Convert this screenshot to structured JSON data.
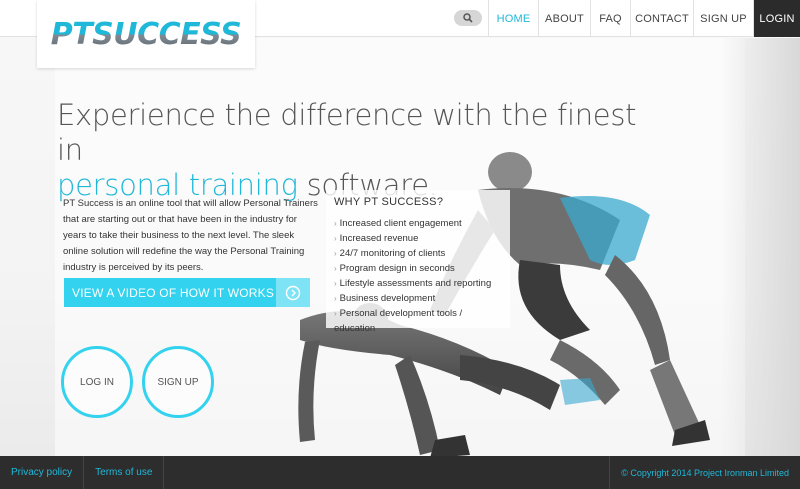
{
  "brand": {
    "logo_text": "PTSUCCESS"
  },
  "nav": {
    "items": [
      {
        "label": "HOME",
        "active": true
      },
      {
        "label": "ABOUT"
      },
      {
        "label": "FAQ"
      },
      {
        "label": "CONTACT"
      },
      {
        "label": "SIGN UP"
      },
      {
        "label": "LOGIN"
      }
    ],
    "search_icon": "search-icon"
  },
  "hero": {
    "headline_part1": "Experience the difference with the finest in",
    "headline_accent": "personal training",
    "headline_part2": " software.",
    "intro": "PT Success is an online tool that will allow Personal Trainers that are starting out or that have been in the industry for years to take their business to the next level. The sleek online solution will redefine the way the Personal Training industry is perceived by its peers.",
    "cta_label": "VIEW A VIDEO OF HOW IT WORKS",
    "login_label": "LOG IN",
    "signup_label": "SIGN UP"
  },
  "why": {
    "title": "WHY PT SUCCESS?",
    "items": [
      "Increased client engagement",
      "Increased revenue",
      "24/7 monitoring of clients",
      "Program design in seconds",
      "Lifestyle assessments and reporting",
      "Business development",
      "Personal development tools / education"
    ]
  },
  "footer": {
    "privacy": "Privacy policy",
    "terms": "Terms of use",
    "copyright": "© Copyright 2014 Project Ironman Limited"
  },
  "colors": {
    "accent": "#1fb8d8",
    "cta": "#33d2ee",
    "dark": "#2d2d2d"
  }
}
